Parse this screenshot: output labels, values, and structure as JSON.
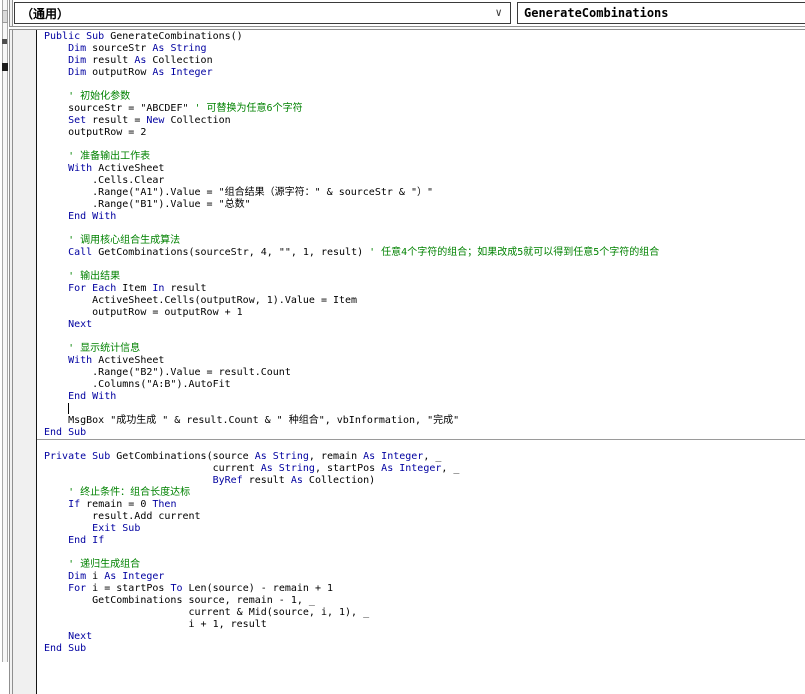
{
  "header": {
    "object_dropdown": {
      "value": "（通用）"
    },
    "procedure_dropdown": {
      "value": "GenerateCombinations"
    },
    "chevron_icon": "∨"
  },
  "colors": {
    "keyword": "#0000a0",
    "comment": "#008200",
    "text": "#000000",
    "margin_bar": "#f0f0f0",
    "separator": "#9a9a9a"
  },
  "code": {
    "caret": {
      "line": 31,
      "column": 4
    },
    "separator_before_line": 34,
    "lines": [
      [
        [
          "k",
          "Public Sub "
        ],
        [
          "n",
          "GenerateCombinations()"
        ]
      ],
      [
        [
          "n",
          "    "
        ],
        [
          "k",
          "Dim"
        ],
        [
          "n",
          " sourceStr "
        ],
        [
          "k",
          "As String"
        ]
      ],
      [
        [
          "n",
          "    "
        ],
        [
          "k",
          "Dim"
        ],
        [
          "n",
          " result "
        ],
        [
          "k",
          "As"
        ],
        [
          "n",
          " Collection"
        ]
      ],
      [
        [
          "n",
          "    "
        ],
        [
          "k",
          "Dim"
        ],
        [
          "n",
          " outputRow "
        ],
        [
          "k",
          "As Integer"
        ]
      ],
      [],
      [
        [
          "c",
          "    ' 初始化参数"
        ]
      ],
      [
        [
          "n",
          "    sourceStr = \"ABCDEF\" "
        ],
        [
          "c",
          "' 可替换为任意6个字符"
        ]
      ],
      [
        [
          "n",
          "    "
        ],
        [
          "k",
          "Set"
        ],
        [
          "n",
          " result = "
        ],
        [
          "k",
          "New"
        ],
        [
          "n",
          " Collection"
        ]
      ],
      [
        [
          "n",
          "    outputRow = 2"
        ]
      ],
      [],
      [
        [
          "c",
          "    ' 准备输出工作表"
        ]
      ],
      [
        [
          "n",
          "    "
        ],
        [
          "k",
          "With"
        ],
        [
          "n",
          " ActiveSheet"
        ]
      ],
      [
        [
          "n",
          "        .Cells.Clear"
        ]
      ],
      [
        [
          "n",
          "        .Range(\"A1\").Value = \"组合结果（源字符：\" & sourceStr & \"）\""
        ]
      ],
      [
        [
          "n",
          "        .Range(\"B1\").Value = \"总数\""
        ]
      ],
      [
        [
          "n",
          "    "
        ],
        [
          "k",
          "End With"
        ]
      ],
      [],
      [
        [
          "c",
          "    ' 调用核心组合生成算法"
        ]
      ],
      [
        [
          "n",
          "    "
        ],
        [
          "k",
          "Call"
        ],
        [
          "n",
          " GetCombinations(sourceStr, 4, \"\", 1, result) "
        ],
        [
          "c",
          "' 任意4个字符的组合；如果改成5就可以得到任意5个字符的组合"
        ]
      ],
      [],
      [
        [
          "c",
          "    ' 输出结果"
        ]
      ],
      [
        [
          "n",
          "    "
        ],
        [
          "k",
          "For Each"
        ],
        [
          "n",
          " Item "
        ],
        [
          "k",
          "In"
        ],
        [
          "n",
          " result"
        ]
      ],
      [
        [
          "n",
          "        ActiveSheet.Cells(outputRow, 1).Value = Item"
        ]
      ],
      [
        [
          "n",
          "        outputRow = outputRow + 1"
        ]
      ],
      [
        [
          "n",
          "    "
        ],
        [
          "k",
          "Next"
        ]
      ],
      [],
      [
        [
          "c",
          "    ' 显示统计信息"
        ]
      ],
      [
        [
          "n",
          "    "
        ],
        [
          "k",
          "With"
        ],
        [
          "n",
          " ActiveSheet"
        ]
      ],
      [
        [
          "n",
          "        .Range(\"B2\").Value = result.Count"
        ]
      ],
      [
        [
          "n",
          "        .Columns(\"A:B\").AutoFit"
        ]
      ],
      [
        [
          "n",
          "    "
        ],
        [
          "k",
          "End With"
        ]
      ],
      [],
      [
        [
          "n",
          "    MsgBox \"成功生成 \" & result.Count & \" 种组合\", vbInformation, \"完成\""
        ]
      ],
      [
        [
          "k",
          "End Sub"
        ]
      ],
      [],
      [
        [
          "k",
          "Private Sub"
        ],
        [
          "n",
          " GetCombinations(source "
        ],
        [
          "k",
          "As String"
        ],
        [
          "n",
          ", remain "
        ],
        [
          "k",
          "As Integer"
        ],
        [
          "n",
          ", _"
        ]
      ],
      [
        [
          "n",
          "                            current "
        ],
        [
          "k",
          "As String"
        ],
        [
          "n",
          ", startPos "
        ],
        [
          "k",
          "As Integer"
        ],
        [
          "n",
          ", _"
        ]
      ],
      [
        [
          "n",
          "                            "
        ],
        [
          "k",
          "ByRef"
        ],
        [
          "n",
          " result "
        ],
        [
          "k",
          "As"
        ],
        [
          "n",
          " Collection)"
        ]
      ],
      [
        [
          "c",
          "    ' 终止条件：组合长度达标"
        ]
      ],
      [
        [
          "n",
          "    "
        ],
        [
          "k",
          "If"
        ],
        [
          "n",
          " remain = 0 "
        ],
        [
          "k",
          "Then"
        ]
      ],
      [
        [
          "n",
          "        result.Add current"
        ]
      ],
      [
        [
          "n",
          "        "
        ],
        [
          "k",
          "Exit Sub"
        ]
      ],
      [
        [
          "n",
          "    "
        ],
        [
          "k",
          "End If"
        ]
      ],
      [],
      [
        [
          "c",
          "    ' 递归生成组合"
        ]
      ],
      [
        [
          "n",
          "    "
        ],
        [
          "k",
          "Dim"
        ],
        [
          "n",
          " i "
        ],
        [
          "k",
          "As Integer"
        ]
      ],
      [
        [
          "n",
          "    "
        ],
        [
          "k",
          "For"
        ],
        [
          "n",
          " i = startPos "
        ],
        [
          "k",
          "To"
        ],
        [
          "n",
          " Len(source) - remain + 1"
        ]
      ],
      [
        [
          "n",
          "        GetCombinations source, remain - 1, _"
        ]
      ],
      [
        [
          "n",
          "                        current & Mid(source, i, 1), _"
        ]
      ],
      [
        [
          "n",
          "                        i + 1, result"
        ]
      ],
      [
        [
          "n",
          "    "
        ],
        [
          "k",
          "Next"
        ]
      ],
      [
        [
          "k",
          "End Sub"
        ]
      ],
      [],
      [],
      []
    ]
  }
}
